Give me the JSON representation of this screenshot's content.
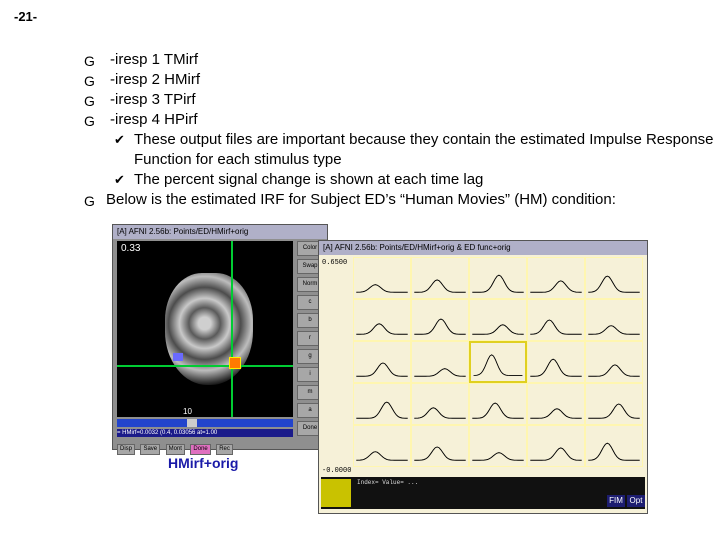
{
  "slide": {
    "number": "-21-"
  },
  "bullets": {
    "items": [
      {
        "text": "-iresp 1 TMirf"
      },
      {
        "text": "-iresp 2 HMirf"
      },
      {
        "text": "-iresp 3 TPirf"
      },
      {
        "text": "-iresp 4 HPirf"
      }
    ],
    "subitems": [
      {
        "text": "These output files are important because they contain the estimated Impulse Response Function for each stimulus type"
      },
      {
        "text": "The percent signal change is shown at each time lag"
      }
    ],
    "last": {
      "text": "Below is the estimated IRF for Subject ED’s “Human Movies” (HM) condition:"
    },
    "marker_icon": "bullet-g-glyph",
    "sub_marker_icon": "bullet-check-glyph"
  },
  "left_window": {
    "title": "[A] AFNI 2.56b: Points/ED/HMirf+orig",
    "coord": "0.33",
    "slider_value": "10",
    "info": "= HMirf=0.0032 (0.4, 0.03056 at=1.00",
    "side_buttons": [
      "Color",
      "Swap",
      "Norm",
      "c",
      "b",
      "r",
      "g",
      "i",
      "m",
      "a",
      "Done"
    ],
    "bottom_buttons": [
      "Disp",
      "Save",
      "Mont",
      "Done",
      "Rec"
    ]
  },
  "caption": "HMirf+orig",
  "right_window": {
    "title": "[A] AFNI 2.56b: Points/ED/HMirf+orig & ED func+orig",
    "ylabel_top": "0.6500",
    "ylabel_bottom": "-0.0000",
    "bottom_info": "Index=  Value= ...",
    "buttons": {
      "fim": "FIM",
      "opt": "Opt"
    }
  },
  "colors": {
    "caption": "#1a1aa8",
    "crosshair": "#00cc33",
    "graph_bg": "#f6f1d8"
  }
}
